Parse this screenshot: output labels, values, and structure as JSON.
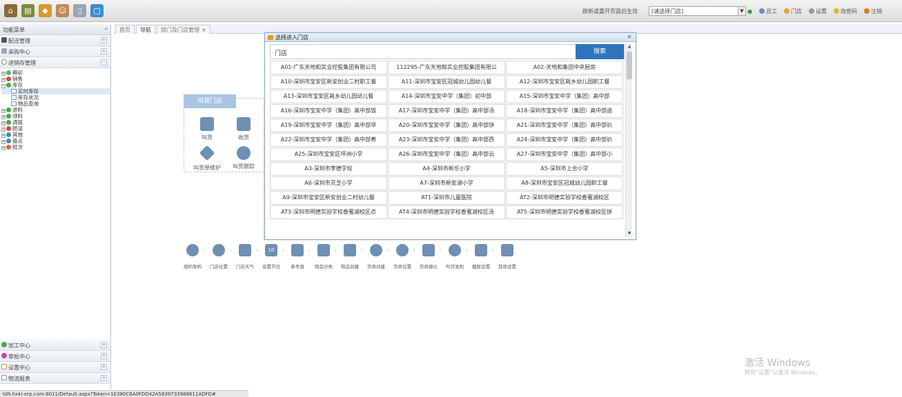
{
  "topbar": {
    "notice": "刷新或重开页面后生效",
    "store_select": "[请选择门店]",
    "links": [
      "员工",
      "门店",
      "设置",
      "改密码",
      "注销"
    ]
  },
  "leftmenu": {
    "title": "功能菜单",
    "sections": [
      {
        "label": "配送管理",
        "color": "#555"
      },
      {
        "label": "采购中心",
        "color": "#8aa"
      },
      {
        "label": "进销存管理",
        "color": "#6a8"
      }
    ],
    "tree": [
      {
        "label": "期初",
        "level": 1,
        "color": "#6a6"
      },
      {
        "label": "销售",
        "level": 1,
        "color": "#d44"
      },
      {
        "label": "库存",
        "level": 1,
        "color": "#4a4"
      },
      {
        "label": "实时库存",
        "level": 2,
        "selected": true
      },
      {
        "label": "库存状况",
        "level": 2
      },
      {
        "label": "物品查询",
        "level": 2
      },
      {
        "label": "退料",
        "level": 1,
        "color": "#4a4"
      },
      {
        "label": "领料",
        "level": 1,
        "color": "#4a4"
      },
      {
        "label": "调拨",
        "level": 1,
        "color": "#4a4"
      },
      {
        "label": "损溢",
        "level": 1,
        "color": "#d44"
      },
      {
        "label": "其他",
        "level": 1,
        "color": "#48b"
      },
      {
        "label": "盘点",
        "level": 1,
        "color": "#48b"
      },
      {
        "label": "批次",
        "level": 1,
        "color": "#d64"
      }
    ],
    "bottom_sections": [
      {
        "label": "加工中心",
        "color": "#4a4"
      },
      {
        "label": "审批中心",
        "color": "#c4a"
      },
      {
        "label": "设置中心",
        "color": "#d84"
      },
      {
        "label": "物流报表",
        "color": "#999"
      }
    ]
  },
  "tabs": [
    {
      "label": "首页",
      "active": false
    },
    {
      "label": "导航",
      "active": true
    },
    {
      "label": "部门及门店管理",
      "active": false,
      "closable": "×"
    }
  ],
  "workflow": {
    "header": "叫货门店",
    "items": [
      "叫货",
      "收货",
      "叫货单维护",
      "叫货跟踪"
    ],
    "steps": [
      "组织架构",
      "门店位置",
      "门店天气",
      "设置节日",
      "参考值",
      "物品分类",
      "物品创建",
      "货商创建",
      "货商位置",
      "货商报价",
      "叫货准则",
      "模版设置",
      "其他设置"
    ],
    "step_badge": "10"
  },
  "modal": {
    "title": "选择进入门店",
    "close": "×",
    "search_label": "门店",
    "search_button": "搜索",
    "stores": [
      "A01-广东天地和实业控股集团有限公司",
      "112295-广东天地和实业控股集团有限公",
      "A02-天地和集团中央厨房",
      "A10-深圳市宝安区新安创业二村职工餐",
      "A11-深圳市宝安区冠城幼儿园幼儿餐",
      "A12-深圳市宝安区耗乡幼儿园职工餐",
      "A13-深圳市宝安区耗乡幼儿园幼儿餐",
      "A14-深圳市宝安中学（集团）初中部",
      "A15-深圳市宝安中学（集团）高中部",
      "A16-深圳市宝安中学（集团）高中部饭",
      "A17-深圳市宝安中学（集团）高中部汤",
      "A18-深圳市宝安中学（集团）高中部卤",
      "A19-深圳市宝安中学（集团）高中部早",
      "A20-深圳市宝安中学（集团）高中部饼",
      "A21-深圳市宝安中学（集团）高中部扒",
      "A22-深圳市宝安中学（集团）高中部煮",
      "A23-深圳市宝安中学（集团）高中部西",
      "A24-深圳市宝安中学（集团）高中部扒",
      "A25-深圳市宝安区坪洲小学",
      "A26-深圳市宝安中学（集团）高中部云",
      "A27-深圳市宝安中学（集团）高中部小",
      "A3-深圳市李德学校",
      "A4-深圳市新乐小学",
      "A5-深圳市上合小学",
      "A6-深圳市灵芝小学",
      "A7-深圳市新安湖小学",
      "A8-深圳市宝安区冠城幼儿园职工餐",
      "A9-深圳市宝安区新安创业二村幼儿餐",
      "AT1-深圳市儿童医院",
      "AT2-深圳市明德实验学校香蜜湖校区",
      "AT3-深圳市明德实验学校香蜜湖校区点",
      "AT4-深圳市明德实验学校香蜜湖校区汤",
      "AT5-深圳市明德实验学校香蜜湖校区饼"
    ]
  },
  "watermark": {
    "line1": "激活 Windows",
    "line2": "转到“设置”以激活 Windows。"
  },
  "status_url": "tdh.hxki-erp.com:8011/Default.aspx?Token=1E380C6A0FDD42A5839733988611ADFD#"
}
